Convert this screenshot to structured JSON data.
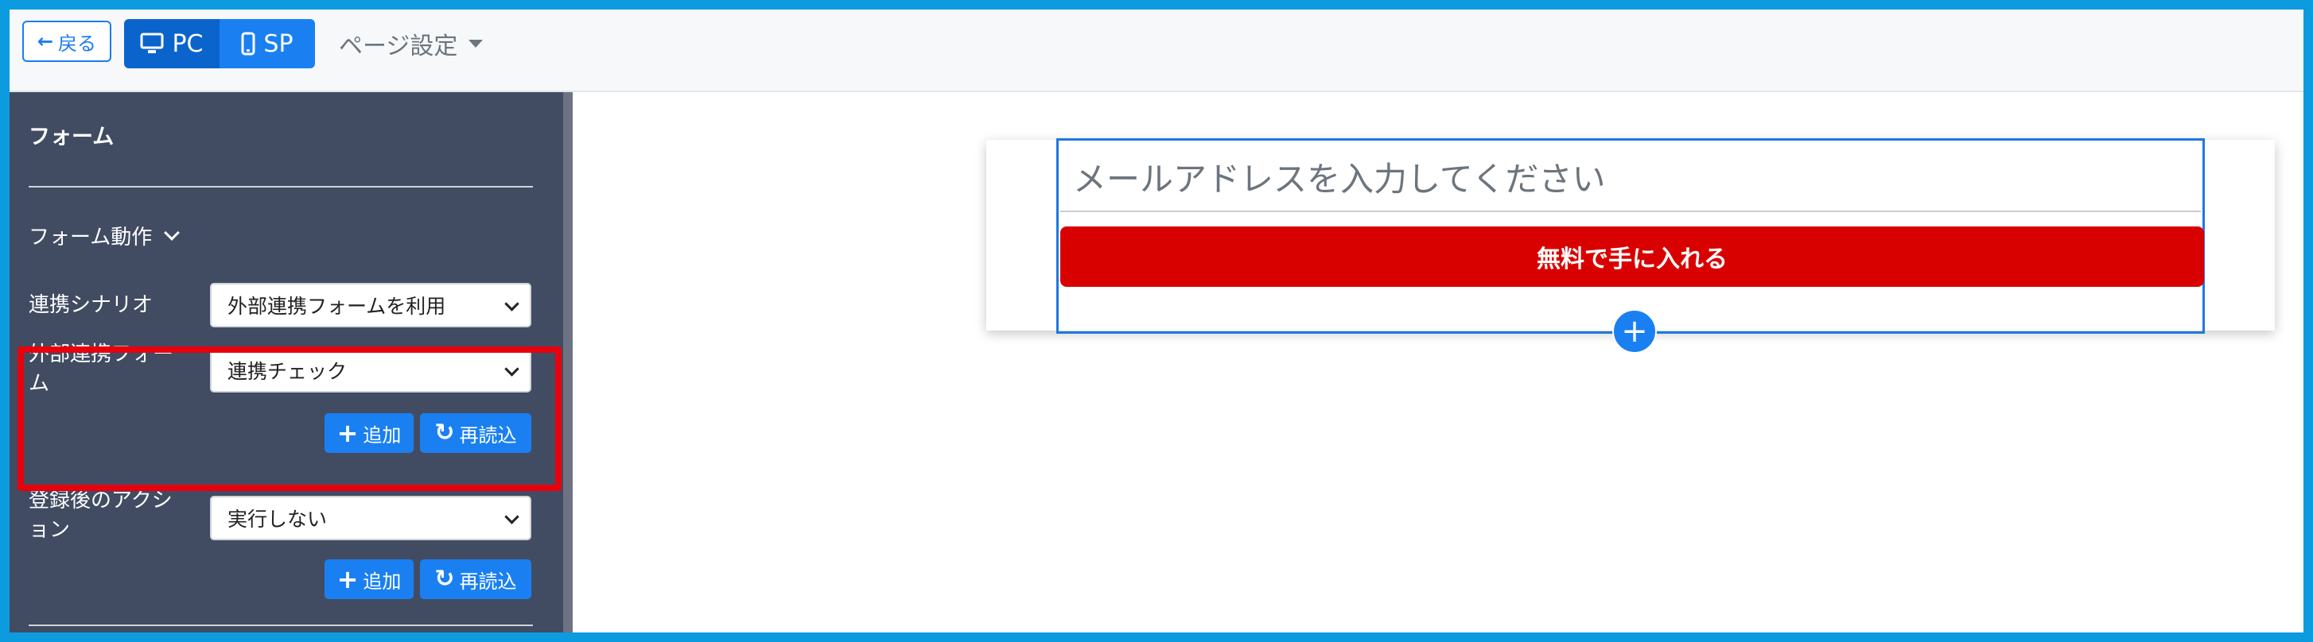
{
  "header": {
    "back_label": "戻る",
    "device_pc_label": "PC",
    "device_sp_label": "SP",
    "page_settings_label": "ページ設定"
  },
  "sidebar": {
    "title": "フォーム",
    "section_label": "フォーム動作",
    "fields": [
      {
        "label": "連携シナリオ",
        "value": "外部連携フォームを利用"
      },
      {
        "label": "外部連携フォーム",
        "value": "連携チェック"
      },
      {
        "label": "登録後のアクション",
        "value": "実行しない"
      }
    ],
    "add_label": "追加",
    "reload_label": "再読込"
  },
  "canvas": {
    "email_placeholder": "メールアドレスを入力してください",
    "cta_label": "無料で手に入れる"
  },
  "colors": {
    "accent": "#1a80f2",
    "sidebar_bg": "#414c63",
    "cta": "#d90000",
    "highlight": "#e8000d",
    "frame": "#0d9be0"
  }
}
